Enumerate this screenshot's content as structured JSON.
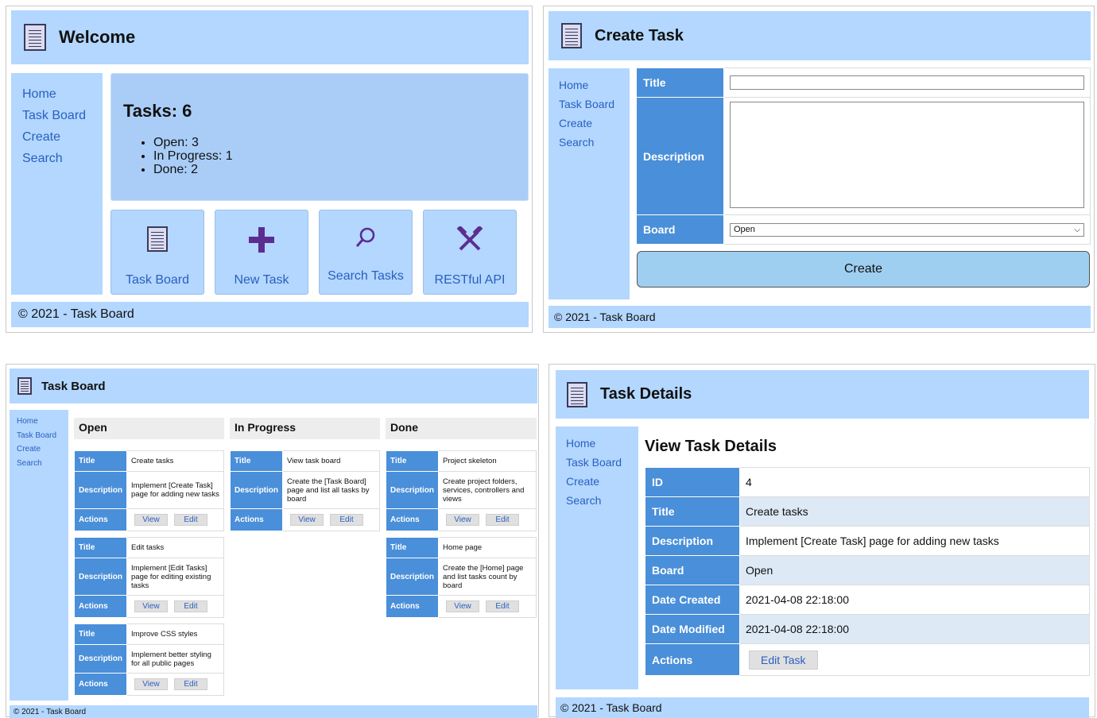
{
  "home": {
    "title": "Welcome",
    "nav": [
      "Home",
      "Task Board",
      "Create",
      "Search"
    ],
    "summary_title": "Tasks: 6",
    "summary_items": [
      "Open: 3",
      "In Progress: 1",
      "Done: 2"
    ],
    "tiles": [
      {
        "label": "Task Board",
        "icon": "document-icon"
      },
      {
        "label": "New Task",
        "icon": "plus-icon"
      },
      {
        "label": "Search Tasks",
        "icon": "search-icon"
      },
      {
        "label": "RESTful API",
        "icon": "tools-icon"
      }
    ],
    "footer": "© 2021 - Task Board"
  },
  "create": {
    "title": "Create Task",
    "nav": [
      "Home",
      "Task Board",
      "Create",
      "Search"
    ],
    "fields": {
      "title_label": "Title",
      "description_label": "Description",
      "board_label": "Board",
      "board_value": "Open"
    },
    "submit_label": "Create",
    "footer": "© 2021 - Task Board"
  },
  "board": {
    "title": "Task Board",
    "nav": [
      "Home",
      "Task Board",
      "Create",
      "Search"
    ],
    "labels": {
      "title": "Title",
      "description": "Description",
      "actions": "Actions",
      "view": "View",
      "edit": "Edit"
    },
    "columns": [
      {
        "name": "Open",
        "cards": [
          {
            "title": "Create tasks",
            "description": "Implement [Create Task] page for adding new tasks"
          },
          {
            "title": "Edit tasks",
            "description": "Implement [Edit Tasks] page for editing existing tasks"
          },
          {
            "title": "Improve CSS styles",
            "description": "Implement better styling for all public pages"
          }
        ]
      },
      {
        "name": "In Progress",
        "cards": [
          {
            "title": "View task board",
            "description": "Create the [Task Board] page and list all tasks by board"
          }
        ]
      },
      {
        "name": "Done",
        "cards": [
          {
            "title": "Project skeleton",
            "description": "Create project folders, services, controllers and views"
          },
          {
            "title": "Home page",
            "description": "Create the [Home] page and list tasks count by board"
          }
        ]
      }
    ],
    "footer": "© 2021 - Task Board"
  },
  "details": {
    "title": "Task Details",
    "nav": [
      "Home",
      "Task Board",
      "Create",
      "Search"
    ],
    "heading": "View Task Details",
    "rows": [
      {
        "label": "ID",
        "value": "4"
      },
      {
        "label": "Title",
        "value": "Create tasks"
      },
      {
        "label": "Description",
        "value": "Implement [Create Task] page for adding new tasks"
      },
      {
        "label": "Board",
        "value": "Open"
      },
      {
        "label": "Date Created",
        "value": "2021-04-08 22:18:00"
      },
      {
        "label": "Date Modified",
        "value": "2021-04-08 22:18:00"
      }
    ],
    "actions_label": "Actions",
    "edit_button": "Edit Task",
    "footer": "© 2021 - Task Board"
  },
  "colors": {
    "header_bg": "#b3d7ff",
    "label_bg": "#4a8fd9",
    "link": "#2a5fbf",
    "icon": "#5c2d91",
    "button_bg": "#9ecff0"
  }
}
